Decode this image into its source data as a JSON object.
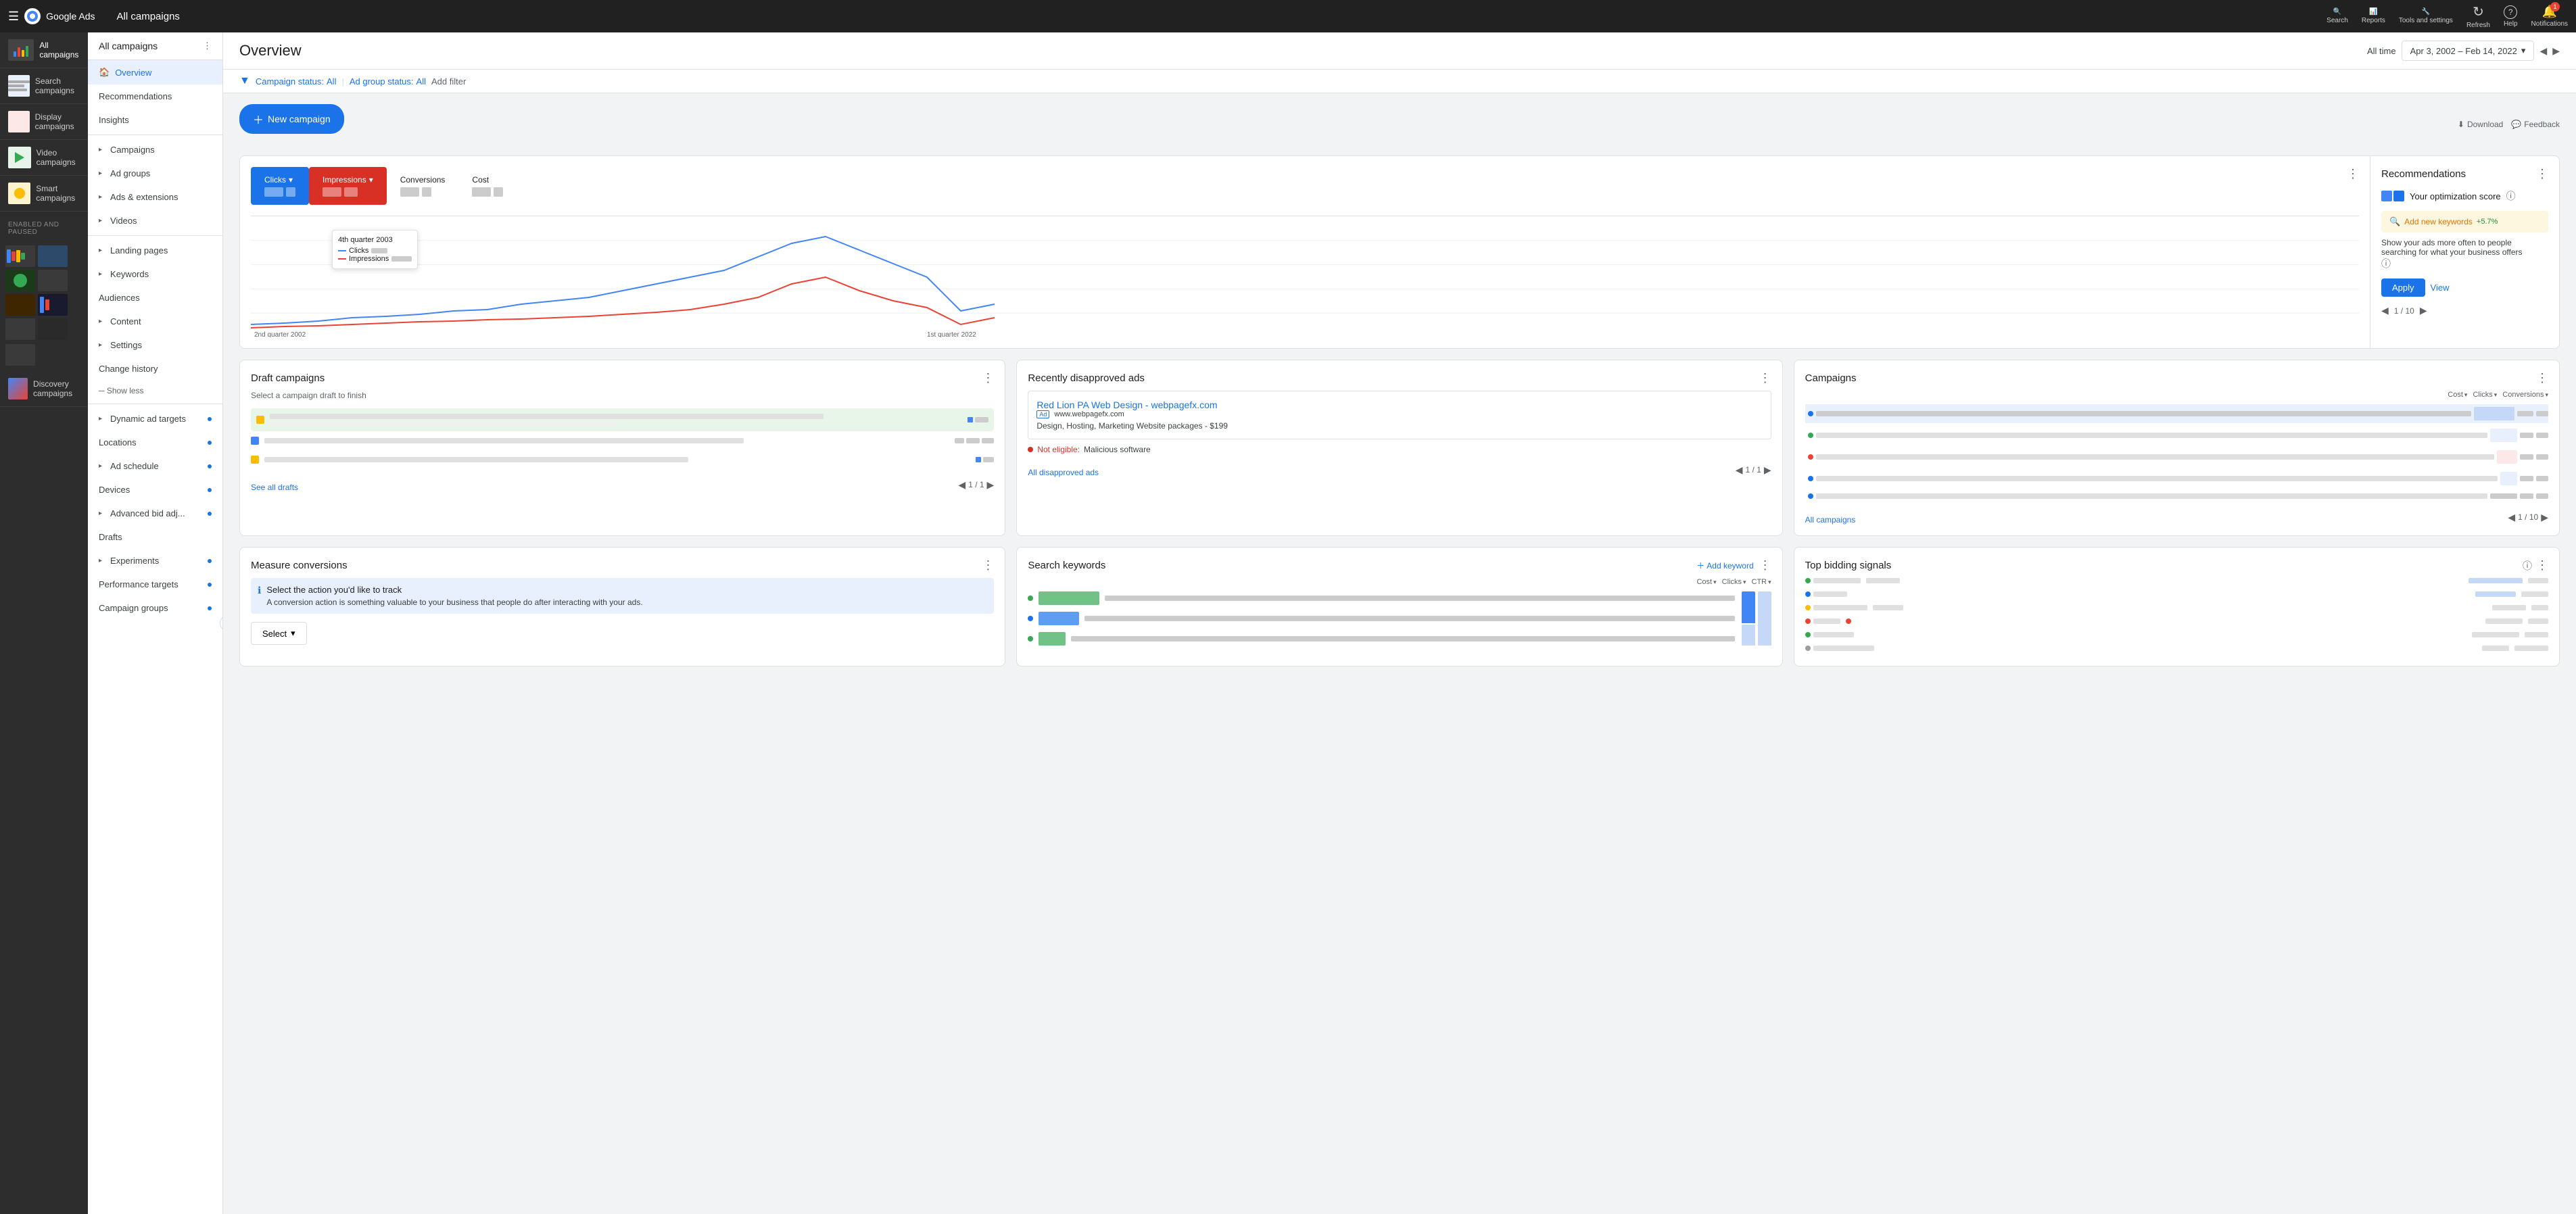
{
  "app": {
    "name": "Google Ads",
    "all_campaigns_title": "All campaigns"
  },
  "topnav": {
    "title": "All campaigns",
    "actions": [
      {
        "id": "search",
        "label": "Search",
        "icon": "🔍"
      },
      {
        "id": "reports",
        "label": "Reports",
        "icon": "📊"
      },
      {
        "id": "tools",
        "label": "Tools and settings",
        "icon": "🔧"
      },
      {
        "id": "refresh",
        "label": "Refresh",
        "icon": "↻"
      },
      {
        "id": "help",
        "label": "Help",
        "icon": "?"
      },
      {
        "id": "notifications",
        "label": "Notifications",
        "icon": "🔔"
      }
    ]
  },
  "campaign_sidebar": {
    "items": [
      {
        "id": "all-campaigns",
        "label": "All campaigns",
        "active": true
      },
      {
        "id": "search-campaigns",
        "label": "Search campaigns"
      },
      {
        "id": "display-campaigns",
        "label": "Display campaigns"
      },
      {
        "id": "video-campaigns",
        "label": "Video campaigns"
      },
      {
        "id": "smart-campaigns",
        "label": "Smart campaigns"
      },
      {
        "id": "discovery-campaigns",
        "label": "Discovery campaigns"
      }
    ],
    "section_label": "Enabled and Paused"
  },
  "inner_sidebar": {
    "active_item": "Overview",
    "items": [
      {
        "id": "overview",
        "label": "Overview",
        "active": true,
        "has_home": true
      },
      {
        "id": "recommendations",
        "label": "Recommendations"
      },
      {
        "id": "insights",
        "label": "Insights"
      },
      {
        "id": "campaigns",
        "label": "Campaigns",
        "expandable": true
      },
      {
        "id": "ad-groups",
        "label": "Ad groups",
        "expandable": true
      },
      {
        "id": "ads-extensions",
        "label": "Ads & extensions",
        "expandable": true
      },
      {
        "id": "videos",
        "label": "Videos",
        "expandable": true
      },
      {
        "id": "landing-pages",
        "label": "Landing pages",
        "expandable": true
      },
      {
        "id": "keywords",
        "label": "Keywords",
        "expandable": true
      },
      {
        "id": "audiences",
        "label": "Audiences"
      },
      {
        "id": "content",
        "label": "Content",
        "expandable": true
      },
      {
        "id": "settings",
        "label": "Settings",
        "expandable": true
      },
      {
        "id": "change-history",
        "label": "Change history"
      },
      {
        "id": "show-less",
        "label": "Show less"
      },
      {
        "id": "dynamic-ad-targets",
        "label": "Dynamic ad targets",
        "expandable": true,
        "has_dot": true
      },
      {
        "id": "locations",
        "label": "Locations",
        "has_dot": true
      },
      {
        "id": "ad-schedule",
        "label": "Ad schedule",
        "expandable": true,
        "has_dot": true
      },
      {
        "id": "devices",
        "label": "Devices",
        "has_dot": true
      },
      {
        "id": "advanced-bid-adj",
        "label": "Advanced bid adj...",
        "expandable": true,
        "has_dot": true
      },
      {
        "id": "drafts",
        "label": "Drafts"
      },
      {
        "id": "experiments",
        "label": "Experiments",
        "expandable": true,
        "has_dot": true
      },
      {
        "id": "performance-targets",
        "label": "Performance targets",
        "has_dot": true
      },
      {
        "id": "campaign-groups",
        "label": "Campaign groups",
        "has_dot": true
      }
    ]
  },
  "page": {
    "title": "Overview",
    "date_label": "All time",
    "date_range": "Apr 3, 2002 – Feb 14, 2022"
  },
  "filter_bar": {
    "filters": [
      {
        "label": "Campaign status: All"
      },
      {
        "label": "Ad group status: All"
      }
    ],
    "add_filter": "Add filter"
  },
  "toolbar": {
    "new_campaign_label": "New campaign",
    "download_label": "Download",
    "feedback_label": "Feedback"
  },
  "metrics": {
    "clicks": {
      "label": "Clicks",
      "active": true,
      "color": "blue"
    },
    "impressions": {
      "label": "Impressions",
      "active": true,
      "color": "red"
    },
    "conversions": {
      "label": "Conversions"
    },
    "cost": {
      "label": "Cost"
    }
  },
  "chart": {
    "tooltip_quarter": "4th quarter 2003",
    "tooltip_clicks": "Clicks",
    "tooltip_impressions": "Impressions",
    "x_start": "2nd quarter 2002",
    "x_end": "1st quarter 2022"
  },
  "recommendations": {
    "title": "Recommendations",
    "optimization_score_label": "Your optimization score",
    "keyword_label": "Add new keywords",
    "keyword_change": "+5.7%",
    "description": "Show your ads more often to people searching for what your business offers",
    "apply_label": "Apply",
    "view_label": "View",
    "pagination": "1 / 10"
  },
  "draft_campaigns": {
    "title": "Draft campaigns",
    "subtitle": "Select a campaign draft to finish",
    "see_all": "See all drafts",
    "pagination": "1 / 1"
  },
  "disapproved_ads": {
    "title": "Recently disapproved ads",
    "ad_title": "Red Lion PA Web Design - webpagefx.com",
    "ad_display_url": "www.webpagefx.com",
    "ad_description": "Design, Hosting, Marketing Website packages - $199",
    "not_eligible_label": "Not eligible:",
    "reason": "Malicious software",
    "all_disapproved": "All disapproved ads",
    "pagination": "1 / 1"
  },
  "campaigns_card": {
    "title": "Campaigns",
    "col_cost": "Cost",
    "col_clicks": "Clicks",
    "col_conversions": "Conversions",
    "all_campaigns_link": "All campaigns",
    "pagination": "1 / 10",
    "rows": [
      {
        "color": "#1a73e8",
        "name_width": 80
      },
      {
        "color": "#34a853",
        "name_width": 60
      },
      {
        "color": "#fbbc04",
        "name_width": 70
      },
      {
        "color": "#ea4335",
        "name_width": 50
      },
      {
        "color": "#1a73e8",
        "name_width": 55
      }
    ]
  },
  "measure_conversions": {
    "title": "Measure conversions",
    "info_text": "Select the action you'd like to track",
    "description": "A conversion action is something valuable to your business that people do after interacting with your ads.",
    "select_label": "Select"
  },
  "search_keywords": {
    "title": "Search keywords",
    "add_keyword": "Add keyword",
    "col_cost": "Cost",
    "col_clicks": "Clicks",
    "col_ctr": "CTR",
    "bars": [
      {
        "color": "#34a853",
        "width": 90
      },
      {
        "color": "#1a73e8",
        "width": 60
      },
      {
        "color": "#34a853",
        "width": 40
      }
    ]
  },
  "top_bidding": {
    "title": "Top bidding signals",
    "rows": [
      {
        "color": "#34a853"
      },
      {
        "color": "#1a73e8"
      },
      {
        "color": "#fbbc04"
      },
      {
        "color": "#ea4335"
      },
      {
        "color": "#34a853"
      },
      {
        "color": "#9e9e9e"
      }
    ]
  }
}
